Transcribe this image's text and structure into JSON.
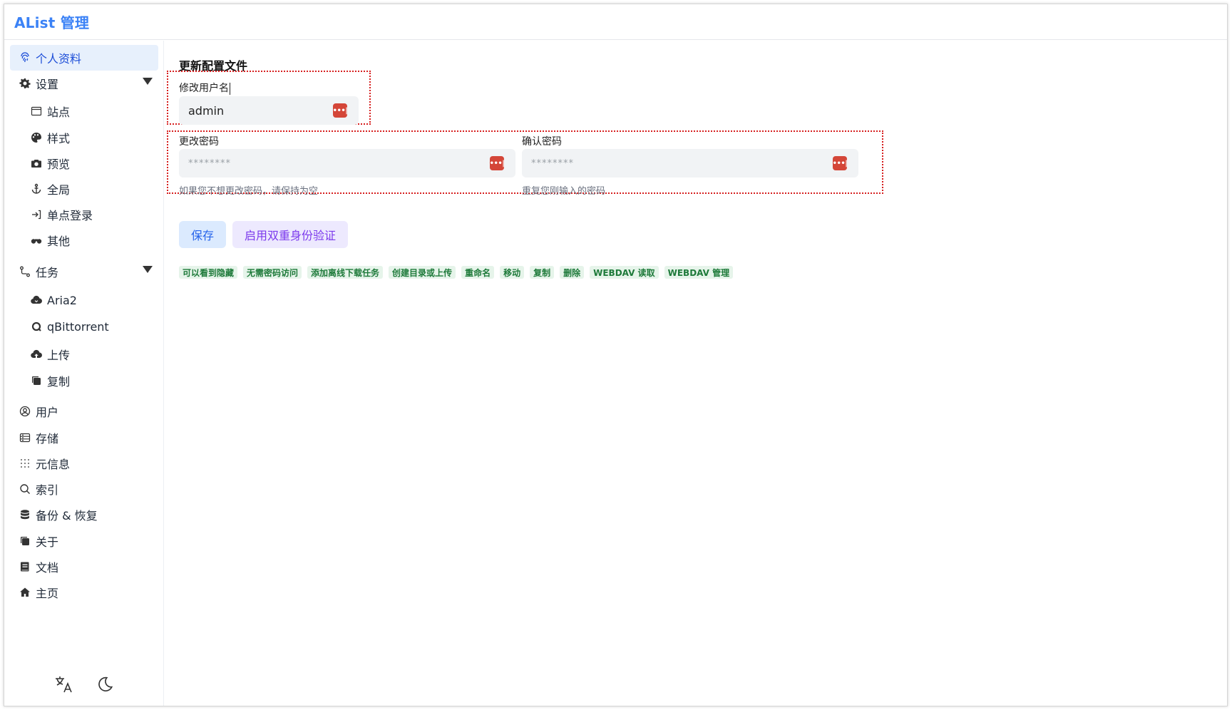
{
  "brand": "AList 管理",
  "sidebar": {
    "items": [
      {
        "label": "个人资料",
        "icon": "fingerprint-icon",
        "active": true
      },
      {
        "label": "设置",
        "icon": "gear-icon"
      },
      {
        "label": "站点",
        "icon": "window-icon"
      },
      {
        "label": "样式",
        "icon": "palette-icon"
      },
      {
        "label": "预览",
        "icon": "camera-icon"
      },
      {
        "label": "全局",
        "icon": "anchor-icon"
      },
      {
        "label": "单点登录",
        "icon": "login-icon"
      },
      {
        "label": "其他",
        "icon": "binoculars-icon"
      },
      {
        "label": "任务",
        "icon": "route-icon"
      },
      {
        "label": "Aria2",
        "icon": "cloud-download-icon"
      },
      {
        "label": "qBittorrent",
        "icon": "qbittorrent-icon"
      },
      {
        "label": "上传",
        "icon": "cloud-upload-icon"
      },
      {
        "label": "复制",
        "icon": "copy-icon"
      },
      {
        "label": "用户",
        "icon": "user-circle-icon"
      },
      {
        "label": "存储",
        "icon": "storage-icon"
      },
      {
        "label": "元信息",
        "icon": "grid-dots-icon"
      },
      {
        "label": "索引",
        "icon": "search-icon"
      },
      {
        "label": "备份 & 恢复",
        "icon": "database-icon"
      },
      {
        "label": "关于",
        "icon": "copy-icon"
      },
      {
        "label": "文档",
        "icon": "book-icon"
      },
      {
        "label": "主页",
        "icon": "home-icon"
      }
    ]
  },
  "main": {
    "title": "更新配置文件",
    "username": {
      "label": "修改用户名",
      "value": "admin"
    },
    "password": {
      "label": "更改密码",
      "placeholder": "********",
      "hint": "如果您不想更改密码，请保持为空"
    },
    "confirm": {
      "label": "确认密码",
      "placeholder": "********",
      "hint": "重复您刚输入的密码"
    },
    "buttons": {
      "save": "保存",
      "twofa": "启用双重身份验证"
    },
    "permissions": [
      "可以看到隐藏",
      "无需密码访问",
      "添加离线下载任务",
      "创建目录或上传",
      "重命名",
      "移动",
      "复制",
      "删除",
      "WEBDAV 读取",
      "WEBDAV 管理"
    ]
  },
  "colors": {
    "brand": "#3b82f6",
    "active_bg": "#e7f0fc",
    "perm_bg": "#e6f4ea",
    "perm_fg": "#1e7a3a",
    "highlight_border": "#d61f1f"
  }
}
